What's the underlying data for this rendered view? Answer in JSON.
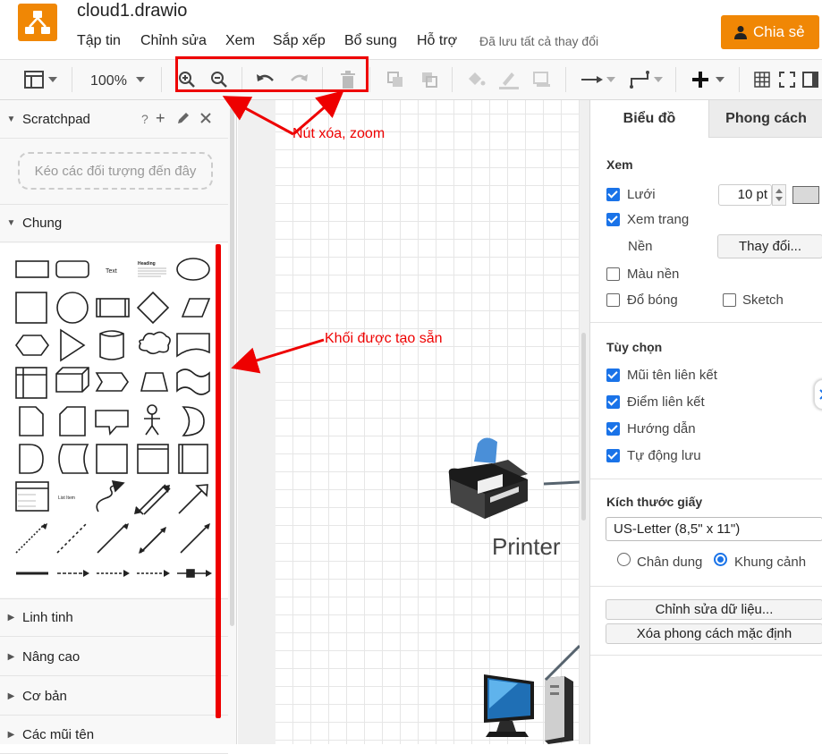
{
  "app": {
    "title": "cloud1.drawio",
    "menus": [
      "Tập tin",
      "Chỉnh sửa",
      "Xem",
      "Sắp xếp",
      "Bổ sung",
      "Hỗ trợ"
    ],
    "saved_status": "Đã lưu tất cả thay đổi",
    "share_label": "Chia sẻ",
    "brand_color": "#f08705"
  },
  "toolbar": {
    "zoom_level": "100%",
    "icons": [
      "format-panel-icon",
      "zoom-in-icon",
      "zoom-out-icon",
      "undo-icon",
      "redo-icon",
      "delete-icon",
      "to-front-icon",
      "to-back-icon",
      "fill-color-icon",
      "line-color-icon",
      "shadow-icon",
      "connection-icon",
      "waypoints-icon",
      "insert-icon",
      "table-icon",
      "fullscreen-icon",
      "format-toggle-icon"
    ]
  },
  "sidebar": {
    "scratchpad_label": "Scratchpad",
    "scratchpad_actions": [
      "?",
      "+"
    ],
    "dropzone_text": "Kéo các đối tượng đến đây",
    "general_label": "Chung",
    "shape_texts": {
      "text": "Text",
      "heading": "Heading",
      "list_item": "List Item"
    },
    "sections": [
      "Linh tinh",
      "Nâng cao",
      "Cơ bản",
      "Các mũi tên"
    ]
  },
  "canvas": {
    "printer_label": "Printer"
  },
  "format_panel": {
    "tabs": [
      "Biểu đồ",
      "Phong cách"
    ],
    "view": {
      "heading": "Xem",
      "grid_label": "Lưới",
      "grid_checked": true,
      "grid_size": "10 pt",
      "page_view_label": "Xem trang",
      "page_view_checked": true,
      "background_label": "Nền",
      "change_button": "Thay đổi...",
      "bg_color_label": "Màu nền",
      "bg_color_checked": false,
      "shadow_label": "Đổ bóng",
      "shadow_checked": false,
      "sketch_label": "Sketch",
      "sketch_checked": false
    },
    "options": {
      "heading": "Tùy chọn",
      "items": [
        {
          "label": "Mũi tên liên kết",
          "checked": true
        },
        {
          "label": "Điểm liên kết",
          "checked": true
        },
        {
          "label": "Hướng dẫn",
          "checked": true
        },
        {
          "label": "Tự động lưu",
          "checked": true
        }
      ]
    },
    "paper": {
      "heading": "Kích thước giấy",
      "size": "US-Letter (8,5\" x 11\")",
      "portrait_label": "Chân dung",
      "landscape_label": "Khung cảnh",
      "orientation": "landscape"
    },
    "edit_data_button": "Chỉnh sửa dữ liệu...",
    "clear_style_button": "Xóa phong cách mặc định"
  },
  "annotations": {
    "toolbar_note": "Nút xóa, zoom",
    "shapes_note": "Khối được tạo sẵn",
    "color": "#e00000"
  }
}
